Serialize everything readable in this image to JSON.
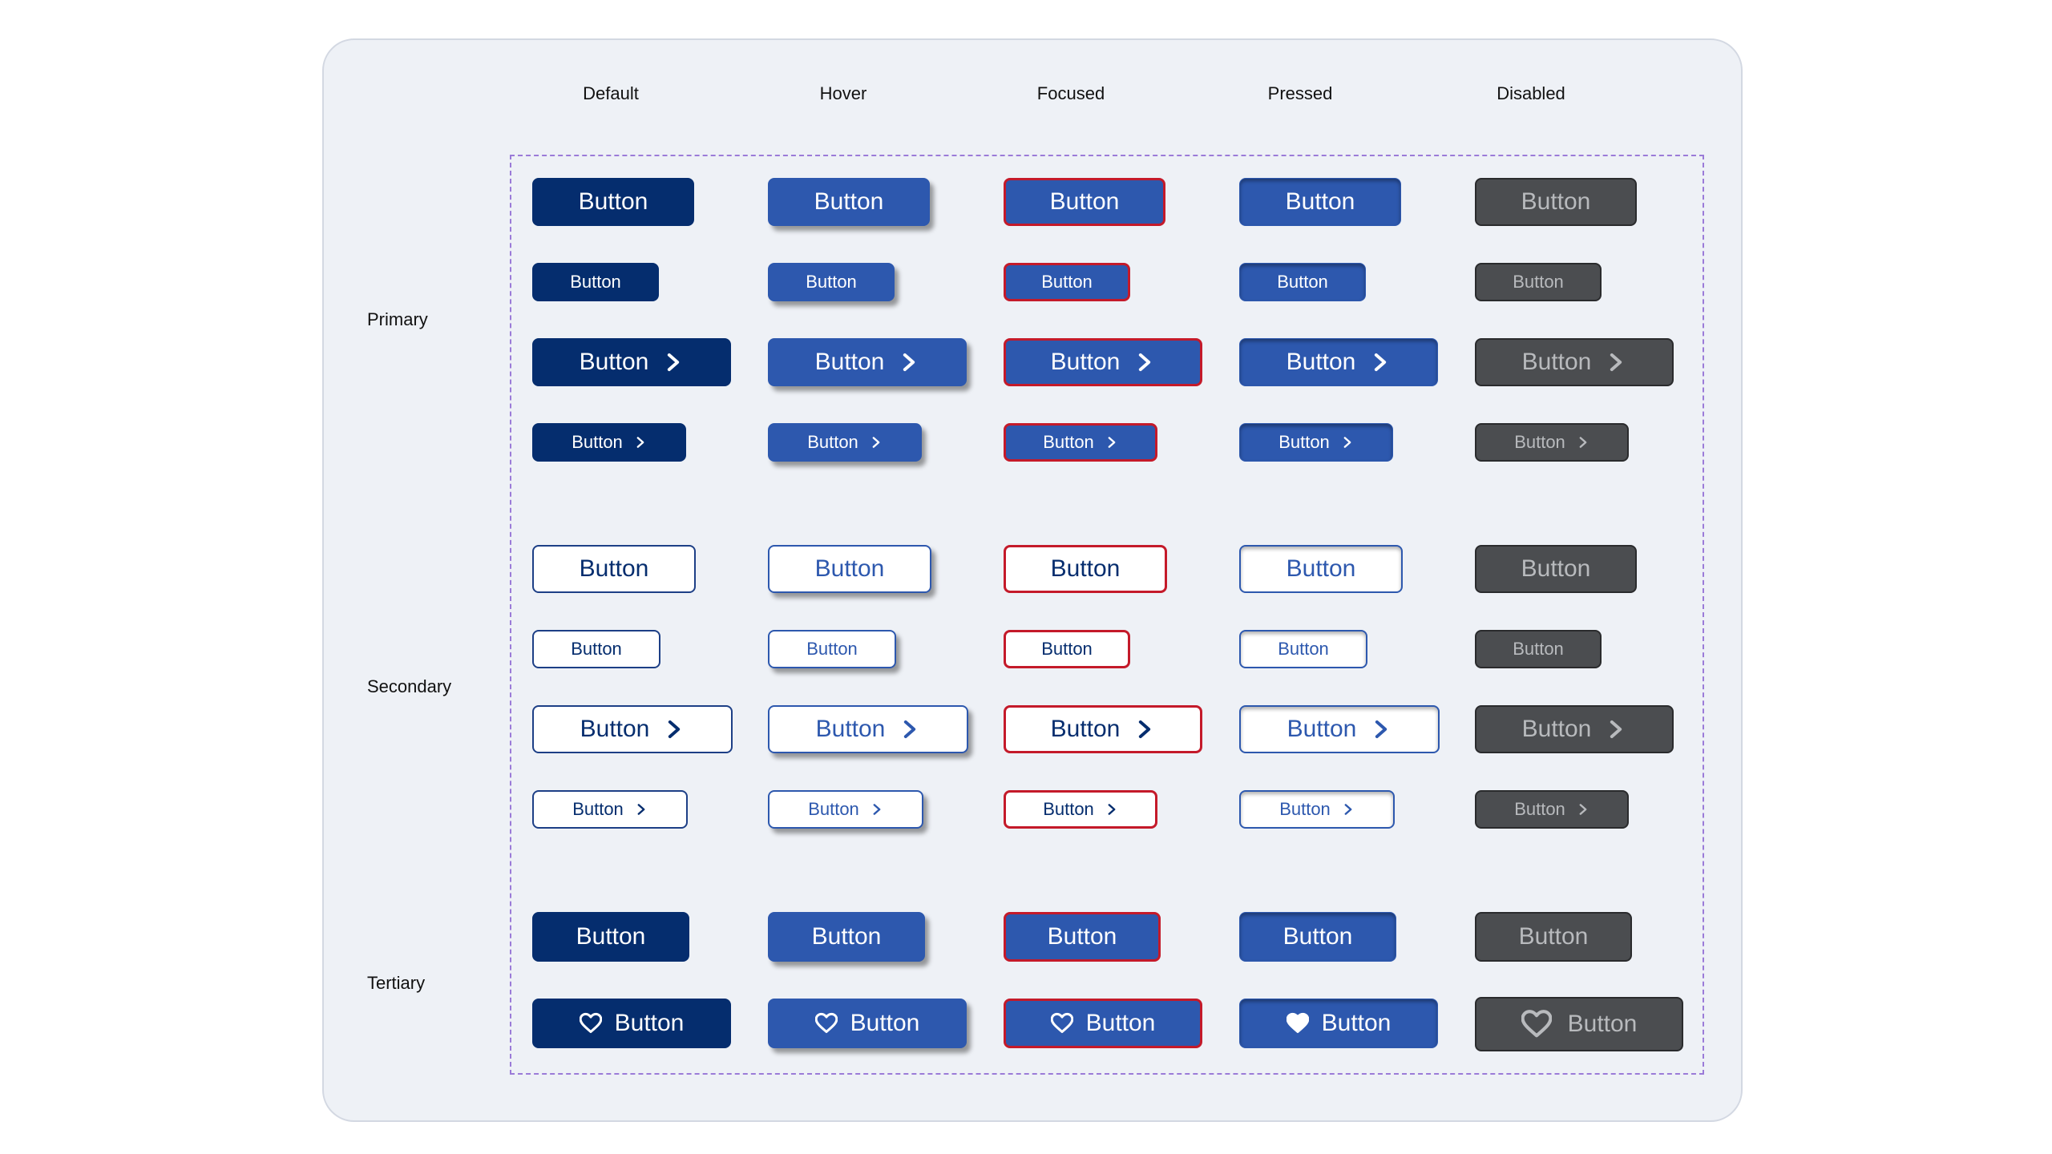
{
  "columns": [
    "Default",
    "Hover",
    "Focused",
    "Pressed",
    "Disabled"
  ],
  "rows": {
    "primary": "Primary",
    "secondary": "Secondary",
    "tertiary": "Tertiary"
  },
  "button_label": "Button",
  "icons": {
    "chevron": "chevron-right-icon",
    "heart": "heart-icon"
  },
  "colors": {
    "primary_default": "#052d6e",
    "primary_active": "#2d58ae",
    "focus_ring": "#c41a2a",
    "disabled_fill": "#4b4d50",
    "disabled_text": "#b8babd",
    "dashed_outline": "#9b7bd8"
  }
}
